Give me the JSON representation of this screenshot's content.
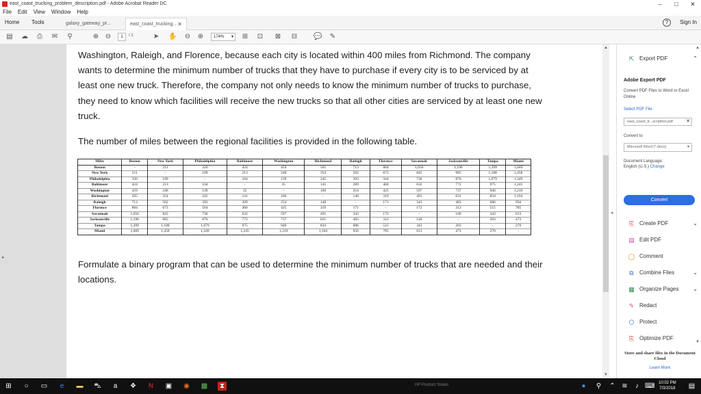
{
  "window": {
    "title": "east_coast_trucking_problem_description.pdf - Adobe Acrobat Reader DC",
    "controls": [
      "–",
      "□",
      "✕"
    ]
  },
  "menu": [
    "File",
    "Edit",
    "View",
    "Window",
    "Help"
  ],
  "tabs": {
    "home": "Home",
    "tools": "Tools",
    "documents": [
      {
        "label": "galaxy_gateway_pr..."
      },
      {
        "label": "east_coast_trucking...",
        "close": "✕"
      }
    ],
    "help": "?",
    "signin": "Sign In"
  },
  "toolbar": {
    "page_current": "1",
    "page_total": "/ 1",
    "zoom": "174%"
  },
  "document": {
    "para1": "Washington, Raleigh, and Florence, because each city is located within 400 miles from Richmond. The company wants to determine the minimum number of trucks that they have to purchase if every city is to be serviced by at least one new truck. Therefore, the company not only needs to know the minimum number of trucks to purchase, they need to know which facilities will receive the new trucks so that all other cities are serviced by at least one new truck.",
    "para2": "The number of miles between the regional facilities is provided in the following table.",
    "para3": "Formulate a binary program that can be used to determine the minimum number of trucks that are needed and their locations.",
    "table": {
      "headers": [
        "Miles",
        "Boston",
        "New York",
        "Philadelphia",
        "Baltimore",
        "Washington",
        "Richmond",
        "Raleigh",
        "Florence",
        "Savannah",
        "Jacksonville",
        "Tampa",
        "Miami"
      ],
      "rows": [
        [
          "Boston",
          "-",
          "211",
          "320",
          "424",
          "459",
          "565",
          "713",
          "884",
          "1,056",
          "1,196",
          "1,399",
          "1,669"
        ],
        [
          "New York",
          "211",
          "-",
          "109",
          "213",
          "248",
          "354",
          "502",
          "673",
          "845",
          "985",
          "1,188",
          "1,458"
        ],
        [
          "Philadelphia",
          "320",
          "109",
          "-",
          "104",
          "139",
          "245",
          "393",
          "564",
          "736",
          "876",
          "1,079",
          "1,349"
        ],
        [
          "Baltimore",
          "424",
          "213",
          "104",
          "-",
          "35",
          "141",
          "289",
          "460",
          "632",
          "772",
          "975",
          "1,245"
        ],
        [
          "Washington",
          "459",
          "248",
          "139",
          "35",
          "-",
          "106",
          "254",
          "425",
          "597",
          "737",
          "940",
          "1,210"
        ],
        [
          "Richmond",
          "565",
          "354",
          "245",
          "141",
          "106",
          "-",
          "148",
          "319",
          "491",
          "631",
          "834",
          "1,104"
        ],
        [
          "Raleigh",
          "713",
          "502",
          "393",
          "289",
          "254",
          "148",
          "-",
          "171",
          "343",
          "483",
          "686",
          "956"
        ],
        [
          "Florence",
          "884",
          "673",
          "564",
          "460",
          "425",
          "319",
          "171",
          "-",
          "172",
          "312",
          "515",
          "785"
        ],
        [
          "Savannah",
          "1,056",
          "845",
          "736",
          "632",
          "597",
          "491",
          "343",
          "172",
          "-",
          "140",
          "343",
          "613"
        ],
        [
          "Jacksonville",
          "1,196",
          "985",
          "876",
          "772",
          "737",
          "631",
          "483",
          "312",
          "140",
          "-",
          "203",
          "473"
        ],
        [
          "Tampa",
          "1,399",
          "1,188",
          "1,079",
          "975",
          "940",
          "834",
          "686",
          "515",
          "343",
          "203",
          "-",
          "270"
        ],
        [
          "Miami",
          "1,669",
          "1,458",
          "1,349",
          "1,245",
          "1,210",
          "1,104",
          "956",
          "785",
          "613",
          "473",
          "270",
          "-"
        ]
      ]
    }
  },
  "right_pane": {
    "export_pdf": "Export PDF",
    "export_title": "Adobe Export PDF",
    "export_desc": "Convert PDF Files to Word or Excel Online",
    "select_pdf": "Select PDF File",
    "file_name": "east_coast_tr...scription.pdf",
    "convert_to": "Convert to",
    "convert_format": "Microsoft Word (*.docx)",
    "doc_language_label": "Document Language:",
    "doc_language_value": "English (U.S.)",
    "change": "Change",
    "convert_button": "Convert",
    "tools": [
      {
        "label": "Create PDF",
        "icon": "create-pdf-icon",
        "chevron": "⌄"
      },
      {
        "label": "Edit PDF",
        "icon": "edit-pdf-icon"
      },
      {
        "label": "Comment",
        "icon": "comment-icon"
      },
      {
        "label": "Combine Files",
        "icon": "combine-icon",
        "chevron": "⌄"
      },
      {
        "label": "Organize Pages",
        "icon": "organize-icon",
        "chevron": "⌄"
      },
      {
        "label": "Redact",
        "icon": "redact-icon"
      },
      {
        "label": "Protect",
        "icon": "protect-icon"
      },
      {
        "label": "Optimize PDF",
        "icon": "optimize-icon"
      }
    ],
    "store_text": "Store and share files in the Document Cloud",
    "learn_more": "Learn More"
  },
  "taskbar": {
    "hp_text": "HP Product States",
    "time": "10:02 PM",
    "date": "7/3/2018"
  },
  "colors": {
    "accent_blue": "#2d6ee0",
    "acrobat_red": "#d4261c",
    "taskbar": "#101010"
  }
}
